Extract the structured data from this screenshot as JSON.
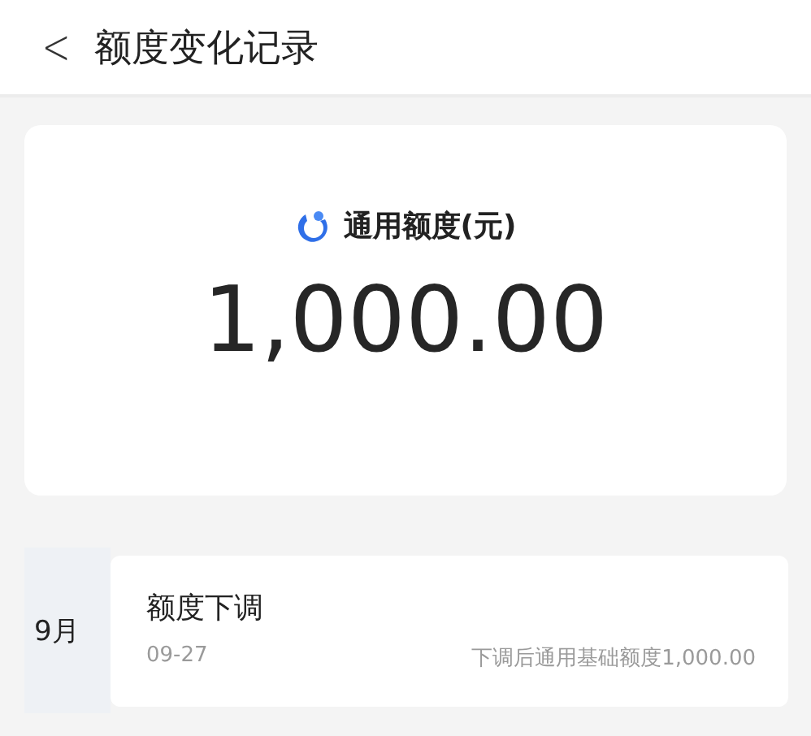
{
  "header": {
    "back": "<",
    "title": "额度变化记录"
  },
  "summary": {
    "label": "通用额度(元)",
    "amount": "1,000.00"
  },
  "records": [
    {
      "month": "9月",
      "title": "额度下调",
      "date": "09-27",
      "detail": "下调后通用基础额度1,000.00"
    }
  ]
}
